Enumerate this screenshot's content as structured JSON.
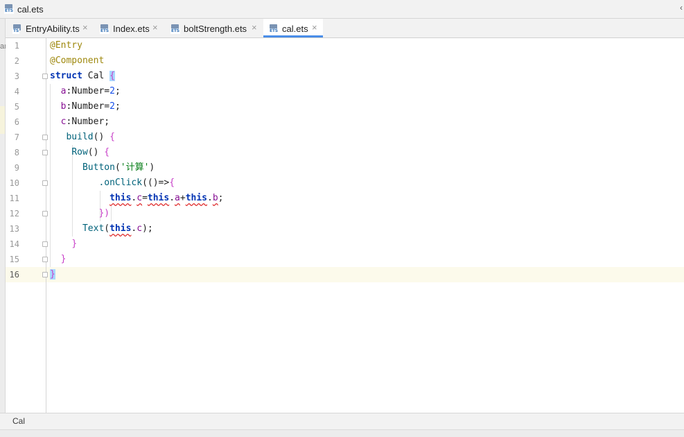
{
  "window": {
    "title": "cal.ets",
    "title_icon": "ets-file-icon"
  },
  "tabs": [
    {
      "label": "EntryAbility.ts",
      "icon_badge": "TS",
      "active": false
    },
    {
      "label": "Index.ets",
      "icon_badge": "ETS",
      "active": false
    },
    {
      "label": "boltStrength.ets",
      "icon_badge": "ETS",
      "active": false
    },
    {
      "label": "cal.ets",
      "icon_badge": "ETS",
      "active": true
    }
  ],
  "close_glyph": "×",
  "editor": {
    "current_line": 16,
    "line_numbers": [
      "1",
      "2",
      "3",
      "4",
      "5",
      "6",
      "7",
      "8",
      "9",
      "10",
      "11",
      "12",
      "13",
      "14",
      "15",
      "16"
    ],
    "lines": [
      [
        [
          "ann",
          "@Entry"
        ]
      ],
      [
        [
          "ann",
          "@Component"
        ]
      ],
      [
        [
          "kwb",
          "struct"
        ],
        [
          "ident",
          " Cal "
        ],
        [
          "braceh",
          "{"
        ]
      ],
      [
        [
          "ident",
          "  "
        ],
        [
          "prop",
          "a"
        ],
        [
          "punc",
          ":"
        ],
        [
          "cls",
          "Number"
        ],
        [
          "punc",
          "="
        ],
        [
          "num",
          "2"
        ],
        [
          "punc",
          ";"
        ]
      ],
      [
        [
          "ident",
          "  "
        ],
        [
          "prop",
          "b"
        ],
        [
          "punc",
          ":"
        ],
        [
          "cls",
          "Number"
        ],
        [
          "punc",
          "="
        ],
        [
          "num",
          "2"
        ],
        [
          "punc",
          ";"
        ]
      ],
      [
        [
          "ident",
          "  "
        ],
        [
          "prop",
          "c"
        ],
        [
          "punc",
          ":"
        ],
        [
          "cls",
          "Number"
        ],
        [
          "punc",
          ";"
        ]
      ],
      [
        [
          "ident",
          "   "
        ],
        [
          "fn",
          "build"
        ],
        [
          "punc",
          "() "
        ],
        [
          "brace",
          "{"
        ]
      ],
      [
        [
          "ident",
          "    "
        ],
        [
          "fn",
          "Row"
        ],
        [
          "punc",
          "() "
        ],
        [
          "brace",
          "{"
        ]
      ],
      [
        [
          "ident",
          "      "
        ],
        [
          "fn",
          "Button"
        ],
        [
          "punc",
          "("
        ],
        [
          "str",
          "'计算'"
        ],
        [
          "punc",
          ")"
        ]
      ],
      [
        [
          "ident",
          "         "
        ],
        [
          "fn",
          ".onClick"
        ],
        [
          "punc",
          "(()=>"
        ],
        [
          "brace",
          "{"
        ]
      ],
      [
        [
          "ident",
          "           "
        ],
        [
          "kwsq",
          "this"
        ],
        [
          "punc",
          "."
        ],
        [
          "propsq",
          "c"
        ],
        [
          "punc",
          "="
        ],
        [
          "kwsq",
          "this"
        ],
        [
          "punc",
          "."
        ],
        [
          "propsq",
          "a"
        ],
        [
          "punc",
          "+"
        ],
        [
          "kwsq",
          "this"
        ],
        [
          "punc",
          "."
        ],
        [
          "propsq",
          "b"
        ],
        [
          "punc",
          ";"
        ]
      ],
      [
        [
          "ident",
          "         "
        ],
        [
          "brace",
          "})"
        ]
      ],
      [
        [
          "ident",
          "      "
        ],
        [
          "fn",
          "Text"
        ],
        [
          "punc",
          "("
        ],
        [
          "kwsq",
          "this"
        ],
        [
          "punc",
          "."
        ],
        [
          "prop",
          "c"
        ],
        [
          "punc",
          ");"
        ]
      ],
      [
        [
          "ident",
          "    "
        ],
        [
          "brace",
          "}"
        ]
      ],
      [
        [
          "ident",
          "  "
        ],
        [
          "brace",
          "}"
        ]
      ],
      [
        [
          "braceh",
          "}"
        ]
      ]
    ],
    "left_strip_text": "ar"
  },
  "statusbar": {
    "breadcrumb": "Cal"
  },
  "colors": {
    "accent": "#4a8ee8",
    "annotation": "#9e880d",
    "keyword": "#0033b3",
    "string": "#067d17",
    "number": "#1750eb",
    "function": "#00627a",
    "brace": "#c840c8",
    "error_underline": "#e03030"
  }
}
